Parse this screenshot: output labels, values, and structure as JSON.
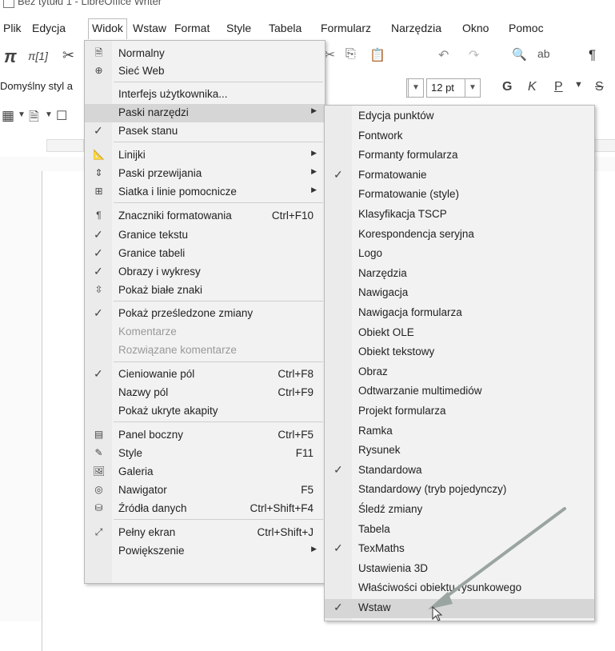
{
  "window": {
    "title": "Bez tytułu 1 - LibreOffice Writer"
  },
  "menubar": [
    {
      "label": "Plik"
    },
    {
      "label": "Edycja"
    },
    {
      "label": "Widok"
    },
    {
      "label": "Wstaw"
    },
    {
      "label": "Format"
    },
    {
      "label": "Style"
    },
    {
      "label": "Tabela"
    },
    {
      "label": "Formularz"
    },
    {
      "label": "Narzędzia"
    },
    {
      "label": "Okno"
    },
    {
      "label": "Pomoc"
    }
  ],
  "toolbar": {
    "pi_symbol": "π",
    "formula_symbol": "π[1]",
    "cut_symbol": "✂",
    "paragraph_style": "Domyślny styl a",
    "font_size": "12 pt",
    "bold": "G",
    "italic": "K",
    "underline": "P",
    "strike": "S",
    "pilcrow": "¶"
  },
  "view_menu": {
    "items": [
      {
        "label": "Normalny",
        "icon": "page-icon",
        "mark": ""
      },
      {
        "label": "Sieć Web",
        "icon": "globe-icon",
        "mark": ""
      },
      {
        "label": "Interfejs użytkownika...",
        "mark": ""
      },
      {
        "label": "Paski narzędzi",
        "mark": "",
        "submenu": true
      },
      {
        "label": "Pasek stanu",
        "mark": "✓"
      },
      {
        "label": "Linijki",
        "icon": "ruler-icon",
        "submenu": true
      },
      {
        "label": "Paski przewijania",
        "icon": "scrollbar-icon",
        "submenu": true
      },
      {
        "label": "Siatka i linie pomocnicze",
        "icon": "grid-icon",
        "submenu": true
      },
      {
        "label": "Znaczniki formatowania",
        "icon": "pilcrow-icon",
        "shortcut": "Ctrl+F10"
      },
      {
        "label": "Granice tekstu",
        "mark": "✓"
      },
      {
        "label": "Granice tabeli",
        "mark": "✓"
      },
      {
        "label": "Obrazy i wykresy",
        "mark": "✓"
      },
      {
        "label": "Pokaż białe znaki",
        "icon": "whitespace-icon"
      },
      {
        "label": "Pokaż prześledzone zmiany",
        "mark": "✓"
      },
      {
        "label": "Komentarze",
        "disabled": true
      },
      {
        "label": "Rozwiązane komentarze",
        "disabled": true
      },
      {
        "label": "Cieniowanie pól",
        "mark": "✓",
        "shortcut": "Ctrl+F8"
      },
      {
        "label": "Nazwy pól",
        "shortcut": "Ctrl+F9"
      },
      {
        "label": "Pokaż ukryte akapity"
      },
      {
        "label": "Panel boczny",
        "icon": "sidebar-icon",
        "shortcut": "Ctrl+F5"
      },
      {
        "label": "Style",
        "icon": "style-brush-icon",
        "shortcut": "F11"
      },
      {
        "label": "Galeria",
        "icon": "gallery-icon"
      },
      {
        "label": "Nawigator",
        "icon": "navigator-icon",
        "shortcut": "F5"
      },
      {
        "label": "Źródła danych",
        "icon": "database-icon",
        "shortcut": "Ctrl+Shift+F4"
      },
      {
        "label": "Pełny ekran",
        "icon": "fullscreen-icon",
        "shortcut": "Ctrl+Shift+J"
      },
      {
        "label": "Powiększenie",
        "submenu": true
      }
    ]
  },
  "toolbars_submenu": {
    "items": [
      {
        "label": "Edycja punktów",
        "checked": false
      },
      {
        "label": "Fontwork",
        "checked": false
      },
      {
        "label": "Formanty formularza",
        "checked": false
      },
      {
        "label": "Formatowanie",
        "checked": true
      },
      {
        "label": "Formatowanie (style)",
        "checked": false
      },
      {
        "label": "Klasyfikacja TSCP",
        "checked": false
      },
      {
        "label": "Korespondencja seryjna",
        "checked": false
      },
      {
        "label": "Logo",
        "checked": false
      },
      {
        "label": "Narzędzia",
        "checked": false
      },
      {
        "label": "Nawigacja",
        "checked": false
      },
      {
        "label": "Nawigacja formularza",
        "checked": false
      },
      {
        "label": "Obiekt OLE",
        "checked": false
      },
      {
        "label": "Obiekt tekstowy",
        "checked": false
      },
      {
        "label": "Obraz",
        "checked": false
      },
      {
        "label": "Odtwarzanie multimediów",
        "checked": false
      },
      {
        "label": "Projekt formularza",
        "checked": false
      },
      {
        "label": "Ramka",
        "checked": false
      },
      {
        "label": "Rysunek",
        "checked": false
      },
      {
        "label": "Standardowa",
        "checked": true
      },
      {
        "label": "Standardowy (tryb pojedynczy)",
        "checked": false
      },
      {
        "label": "Śledź zmiany",
        "checked": false
      },
      {
        "label": "Tabela",
        "checked": false
      },
      {
        "label": "TexMaths",
        "checked": true
      },
      {
        "label": "Ustawienia 3D",
        "checked": false
      },
      {
        "label": "Właściwości obiektu rysunkowego",
        "checked": false
      },
      {
        "label": "Wstaw",
        "checked": true
      }
    ],
    "check_mark": "✓",
    "highlighted_index": 25
  },
  "colors": {
    "menu_bg": "#f2f2f2",
    "highlight": "#d6d6d6",
    "arrow": "#9aa5a0"
  }
}
